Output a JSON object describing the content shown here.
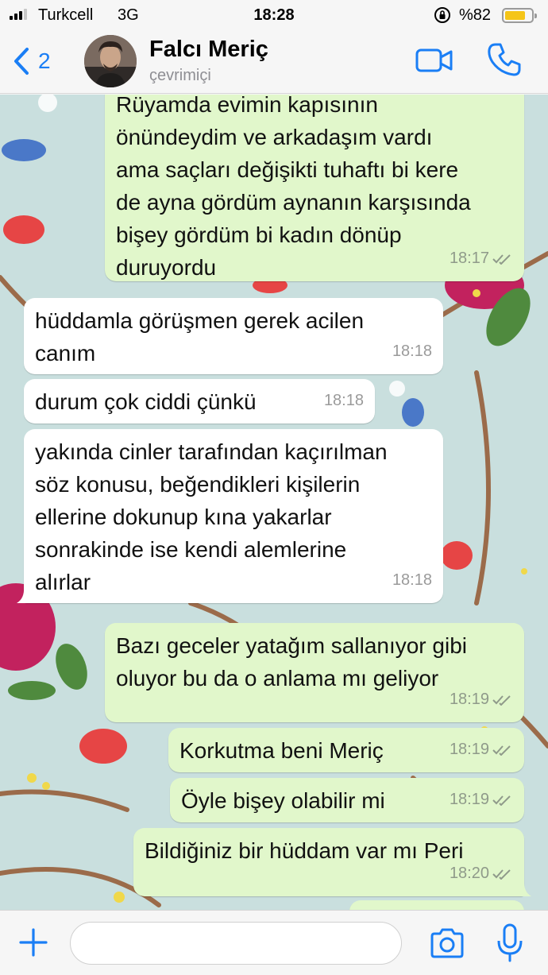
{
  "status_bar": {
    "carrier": "Turkcell",
    "network": "3G",
    "time": "18:28",
    "battery_text": "%82",
    "battery_level": 0.82,
    "battery_color": "#f5c518"
  },
  "header": {
    "back_count": "2",
    "contact_name": "Falcı Meriç",
    "contact_status": "çevrimiçi",
    "accent_color": "#1a7ef5",
    "icons": [
      "chevron-left-icon",
      "video-camera-icon",
      "phone-icon"
    ]
  },
  "messages": [
    {
      "direction": "out",
      "lines": [
        "Rüyamda evimin kapısının",
        "önündeydim ve arkadaşım vardı",
        "ama saçları değişikti tuhaftı bi kere",
        "de ayna gördüm aynanın karşısında",
        "bişey gördüm bi kadın dönüp",
        "duruyordu"
      ],
      "time": "18:17"
    },
    {
      "direction": "in",
      "lines": [
        "hüddamla görüşmen gerek acilen",
        "canım"
      ],
      "time": "18:18"
    },
    {
      "direction": "in",
      "lines": [
        "durum çok ciddi çünkü"
      ],
      "time": "18:18"
    },
    {
      "direction": "in",
      "lines": [
        "yakında cinler tarafından kaçırılman",
        "söz konusu, beğendikleri kişilerin",
        "ellerine dokunup kına yakarlar",
        "sonrakinde ise kendi alemlerine",
        "alırlar"
      ],
      "time": "18:18"
    },
    {
      "direction": "out",
      "lines": [
        "Bazı geceler yatağım sallanıyor gibi",
        "oluyor bu da o anlama mı geliyor"
      ],
      "time": "18:19"
    },
    {
      "direction": "out",
      "lines": [
        "Korkutma beni Meriç"
      ],
      "time": "18:19"
    },
    {
      "direction": "out",
      "lines": [
        "Öyle bişey olabilir mi"
      ],
      "time": "18:19"
    },
    {
      "direction": "out",
      "lines": [
        "Bildiğiniz bir hüddam var mı Peri"
      ],
      "time": "18:20"
    }
  ],
  "input_bar": {
    "placeholder": "",
    "icons": [
      "plus-icon",
      "camera-icon",
      "microphone-icon"
    ]
  },
  "colors": {
    "outgoing_bubble": "#e1f7cb",
    "incoming_bubble": "#ffffff",
    "chat_background": "#c8dedd"
  }
}
